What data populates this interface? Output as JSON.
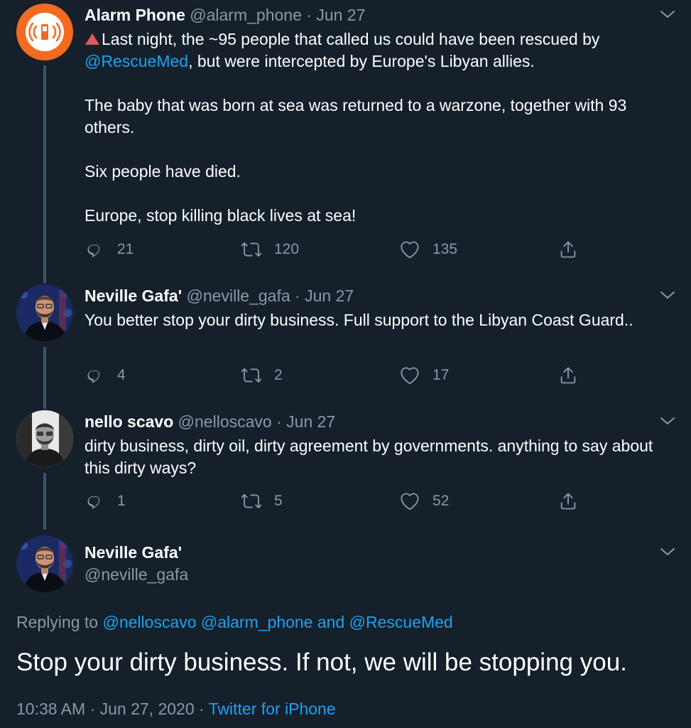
{
  "colors": {
    "background": "#15202b",
    "primary_text": "#ffffff",
    "secondary_text": "#8899a6",
    "link": "#1da1f2",
    "alarm_phone_orange": "#f26b21",
    "thread_line": "#3d5466"
  },
  "tweets": [
    {
      "name": "Alarm Phone",
      "handle": "@alarm_phone",
      "dot": "·",
      "date": "Jun 27",
      "avatar_icon": "phone-signal-icon",
      "emoji": "red-triangle-icon",
      "line1_text": "Last night, the ~95 people that called us could have been rescued by",
      "line2_mention": "@RescueMed",
      "line2_text": ", but were intercepted by Europe's Libyan allies.",
      "para2": "The baby that was born at sea was returned to a warzone, together with 93 others.",
      "para3": "Six people have died.",
      "para4": "Europe, stop killing black lives at sea!",
      "replies": "21",
      "retweets": "120",
      "likes": "135"
    },
    {
      "name": "Neville Gafa'",
      "handle": "@neville_gafa",
      "dot": "·",
      "date": "Jun 27",
      "text": "You better stop your dirty business. Full support to the Libyan Coast Guard..",
      "replies": "4",
      "retweets": "2",
      "likes": "17"
    },
    {
      "name": "nello scavo",
      "handle": "@nelloscavo",
      "dot": "·",
      "date": "Jun 27",
      "text": "dirty business, dirty oil, dirty agreement by governments. anything to say about this dirty ways?",
      "replies": "1",
      "retweets": "5",
      "likes": "52"
    }
  ],
  "main_tweet": {
    "name": "Neville Gafa'",
    "handle": "@neville_gafa",
    "replying_label": "Replying to ",
    "replying_mentions": "@nelloscavo @alarm_phone and @RescueMed",
    "text": "Stop your dirty business. If not, we will be stopping you.",
    "time": "10:38 AM · Jun 27, 2020 · ",
    "source": "Twitter for iPhone"
  }
}
